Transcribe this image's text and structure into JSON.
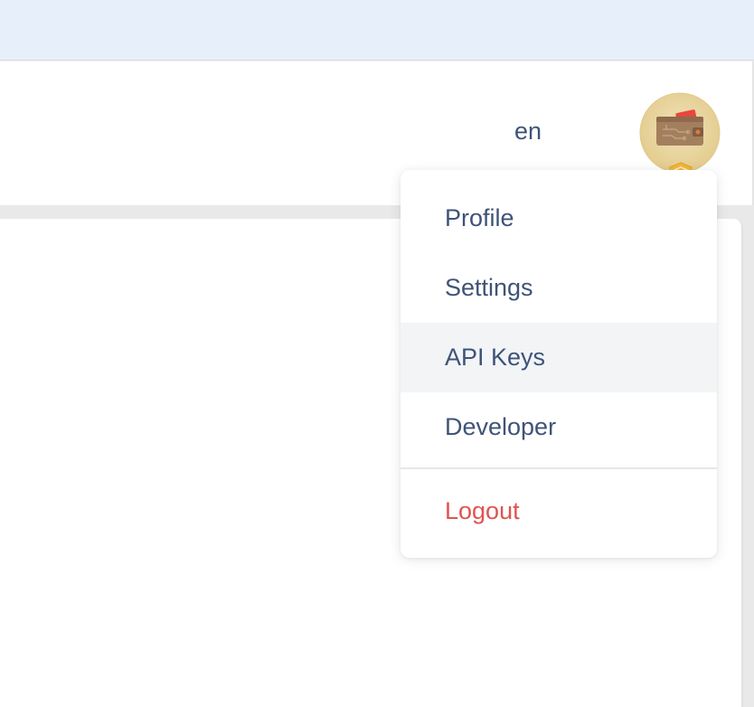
{
  "header": {
    "language": "en"
  },
  "user_menu": {
    "items": [
      {
        "label": "Profile"
      },
      {
        "label": "Settings"
      },
      {
        "label": "API Keys",
        "active": true
      },
      {
        "label": "Developer"
      }
    ],
    "logout_label": "Logout"
  },
  "colors": {
    "banner": "#e7effb",
    "menu_text": "#3f5378",
    "logout_text": "#e05350",
    "active_item_bg": "#f2f4f6",
    "avatar_bg": "#ead7a3",
    "badge": "#f3b73a"
  },
  "icons": {
    "avatar": "wallet-icon",
    "badge": "shield-icon"
  }
}
